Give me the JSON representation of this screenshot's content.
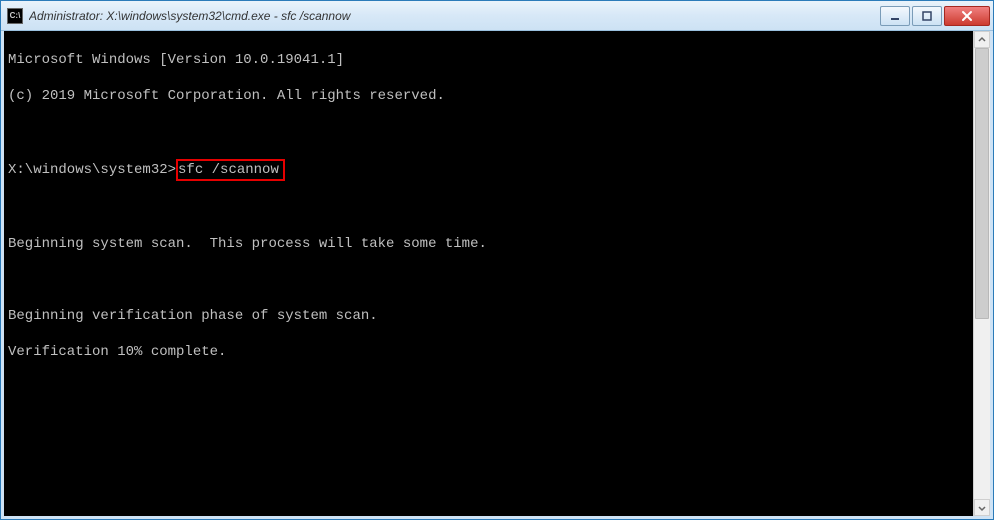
{
  "titlebar": {
    "icon_label": "C:\\",
    "text": "Administrator: X:\\windows\\system32\\cmd.exe - sfc  /scannow"
  },
  "terminal": {
    "line1": "Microsoft Windows [Version 10.0.19041.1]",
    "line2": "(c) 2019 Microsoft Corporation. All rights reserved.",
    "blank1": "",
    "prompt": "X:\\windows\\system32>",
    "command": "sfc /scannow",
    "blank2": "",
    "line3": "Beginning system scan.  This process will take some time.",
    "blank3": "",
    "line4": "Beginning verification phase of system scan.",
    "line5": "Verification 10% complete."
  }
}
